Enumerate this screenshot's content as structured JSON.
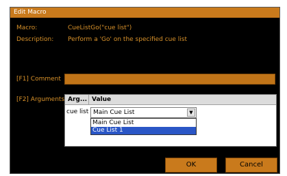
{
  "dialog": {
    "title": "Edit Macro",
    "macro_label": "Macro:",
    "macro_value": "CueListGo(\"cue list\")",
    "description_label": "Description:",
    "description_value": "Perform a 'Go' on the specified cue list",
    "comment_label": "[F1] Comment",
    "comment_value": "",
    "arguments_label": "[F2] Arguments",
    "arguments_table": {
      "columns": [
        "Arg...",
        "Value"
      ],
      "rows": [
        {
          "arg": "cue list",
          "value": "Main Cue List"
        }
      ]
    },
    "dropdown_options": [
      "Main Cue List",
      "Cue List 1"
    ],
    "dropdown_selected": "Cue List 1",
    "ok_label": "OK",
    "cancel_label": "Cancel",
    "colors": {
      "accent": "#c97a1c",
      "label_text": "#d9922a",
      "background": "#000000",
      "selection": "#2a56c6"
    }
  }
}
